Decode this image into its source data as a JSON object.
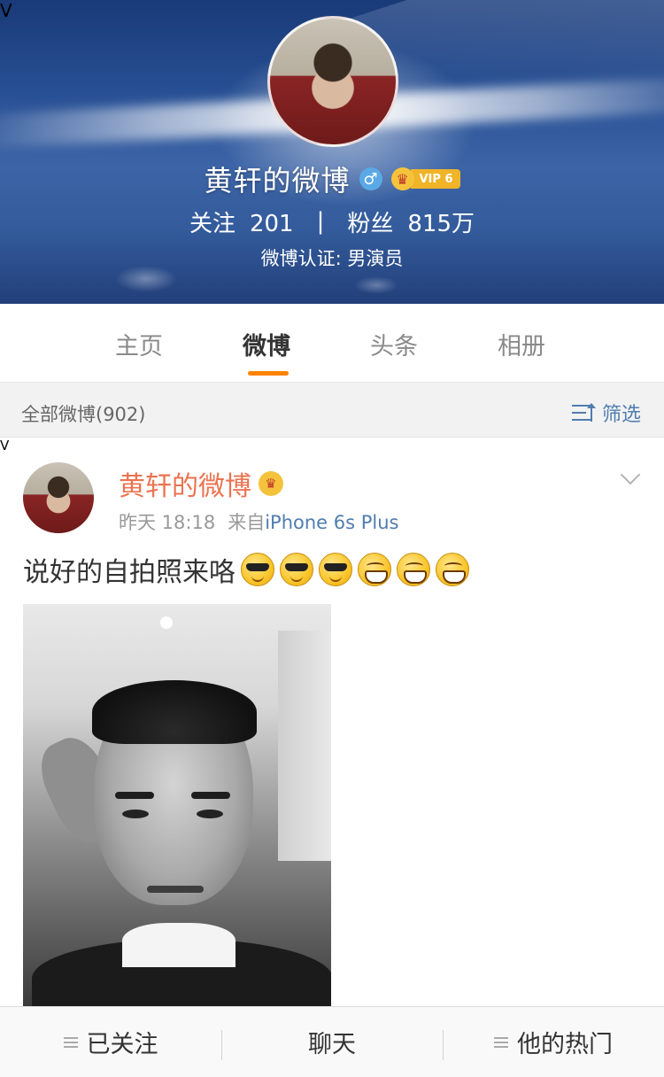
{
  "profile": {
    "name": "黄轩的微博",
    "gender_symbol": "♂",
    "vip_label": "VIP 6",
    "verified_badge": "V",
    "follow_label": "关注",
    "follow_count": "201",
    "separator": "|",
    "fans_label": "粉丝",
    "fans_count": "815万",
    "verification": "微博认证: 男演员"
  },
  "tabs": [
    {
      "label": "主页",
      "active": false
    },
    {
      "label": "微博",
      "active": true
    },
    {
      "label": "头条",
      "active": false
    },
    {
      "label": "相册",
      "active": false
    }
  ],
  "filter": {
    "count_label": "全部微博(902)",
    "filter_label": "筛选"
  },
  "post": {
    "author": "黄轩的微博",
    "verified_badge": "V",
    "time": "昨天 18:18",
    "source_prefix": "来自",
    "source_device": "iPhone 6s Plus",
    "text": "说好的自拍照来咯",
    "emojis": [
      "cool-emoji",
      "cool-emoji",
      "cool-emoji",
      "grin-emoji",
      "grin-emoji",
      "grin-emoji"
    ]
  },
  "bottom_bar": {
    "followed_label": "已关注",
    "chat_label": "聊天",
    "hot_label": "他的热门"
  },
  "colors": {
    "accent": "#ff8200",
    "author_orange": "#eb7350",
    "link_blue": "#507daf"
  }
}
